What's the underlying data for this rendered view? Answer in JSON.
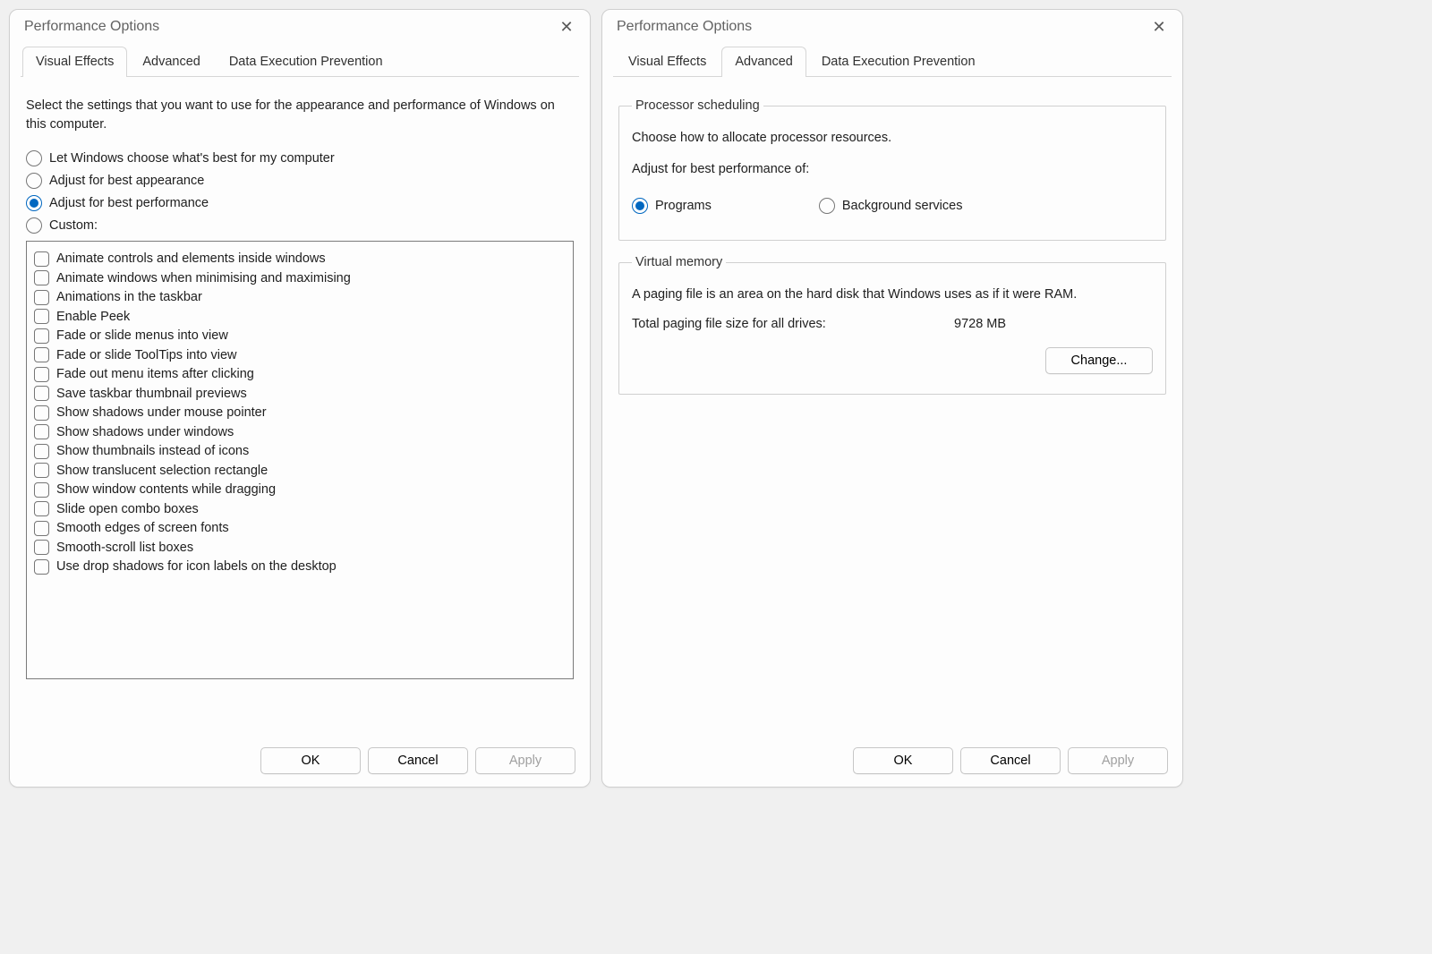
{
  "dialog_title": "Performance Options",
  "tabs": {
    "visual_effects": "Visual Effects",
    "advanced": "Advanced",
    "dep": "Data Execution Prevention"
  },
  "buttons": {
    "ok": "OK",
    "cancel": "Cancel",
    "apply": "Apply",
    "change": "Change..."
  },
  "visual_effects": {
    "intro": "Select the settings that you want to use for the appearance and performance of Windows on this computer.",
    "radios": {
      "auto": "Let Windows choose what's best for my computer",
      "best_appearance": "Adjust for best appearance",
      "best_performance": "Adjust for best performance",
      "custom": "Custom:"
    },
    "effects": [
      "Animate controls and elements inside windows",
      "Animate windows when minimising and maximising",
      "Animations in the taskbar",
      "Enable Peek",
      "Fade or slide menus into view",
      "Fade or slide ToolTips into view",
      "Fade out menu items after clicking",
      "Save taskbar thumbnail previews",
      "Show shadows under mouse pointer",
      "Show shadows under windows",
      "Show thumbnails instead of icons",
      "Show translucent selection rectangle",
      "Show window contents while dragging",
      "Slide open combo boxes",
      "Smooth edges of screen fonts",
      "Smooth-scroll list boxes",
      "Use drop shadows for icon labels on the desktop"
    ]
  },
  "advanced": {
    "processor_scheduling": {
      "legend": "Processor scheduling",
      "desc": "Choose how to allocate processor resources.",
      "adjust_label": "Adjust for best performance of:",
      "programs": "Programs",
      "background": "Background services"
    },
    "virtual_memory": {
      "legend": "Virtual memory",
      "desc": "A paging file is an area on the hard disk that Windows uses as if it were RAM.",
      "total_label": "Total paging file size for all drives:",
      "total_value": "9728 MB"
    }
  }
}
